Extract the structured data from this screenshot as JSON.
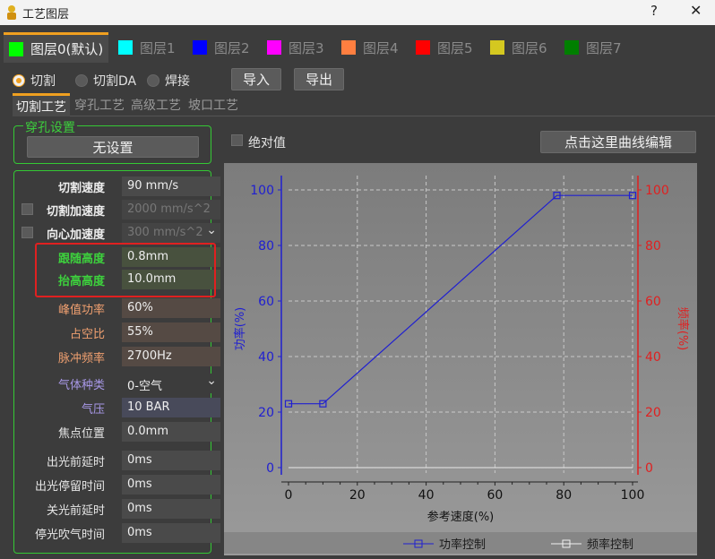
{
  "window": {
    "title": "工艺图层",
    "help": "?",
    "close": "✕"
  },
  "layers": [
    {
      "label": "图层0(默认)",
      "color": "#00ff00"
    },
    {
      "label": "图层1",
      "color": "#00ffff"
    },
    {
      "label": "图层2",
      "color": "#0000ff"
    },
    {
      "label": "图层3",
      "color": "#ff00ff"
    },
    {
      "label": "图层4",
      "color": "#ff7f40"
    },
    {
      "label": "图层5",
      "color": "#ff0000"
    },
    {
      "label": "图层6",
      "color": "#d4c820"
    },
    {
      "label": "图层7",
      "color": "#007f00"
    }
  ],
  "modes": {
    "cut": "切割",
    "cut_da": "切割DA",
    "weld": "焊接",
    "selected": "切割"
  },
  "actions": {
    "import": "导入",
    "export": "导出"
  },
  "sub_tabs": [
    "切割工艺",
    "穿孔工艺",
    "高级工艺",
    "坡口工艺"
  ],
  "pierce": {
    "title": "穿孔设置",
    "button": "无设置"
  },
  "absolute": {
    "label": "绝对值"
  },
  "edit_curve": "点击这里曲线编辑",
  "params": {
    "cut_speed": {
      "label": "切割速度",
      "value": "90 mm/s"
    },
    "cut_accel": {
      "label": "切割加速度",
      "value": "2000 mm/s^2"
    },
    "centri_accel": {
      "label": "向心加速度",
      "value": "300 mm/s^2"
    },
    "follow_height": {
      "label": "跟随高度",
      "value": "0.8mm"
    },
    "lift_height": {
      "label": "抬高高度",
      "value": "10.0mm"
    },
    "peak_power": {
      "label": "峰值功率",
      "value": "60%"
    },
    "duty": {
      "label": "占空比",
      "value": "55%"
    },
    "pulse_freq": {
      "label": "脉冲频率",
      "value": "2700Hz"
    },
    "gas_type": {
      "label": "气体种类",
      "value": "0-空气"
    },
    "pressure": {
      "label": "气压",
      "value": "10 BAR"
    },
    "focus": {
      "label": "焦点位置",
      "value": "0.0mm"
    },
    "pre_delay": {
      "label": "出光前延时",
      "value": "0ms"
    },
    "stay_time": {
      "label": "出光停留时间",
      "value": "0ms"
    },
    "off_delay": {
      "label": "关光前延时",
      "value": "0ms"
    },
    "blow_time": {
      "label": "停光吹气时间",
      "value": "0ms"
    }
  },
  "colors": {
    "green_label": "#3dd13d",
    "orange_label": "#f0a070",
    "purple_label": "#a898e8",
    "power_axis": "#2020d0",
    "freq_axis": "#e02020"
  },
  "chart_data": {
    "type": "line",
    "xlabel": "参考速度(%)",
    "ylabel": "功率(%)",
    "y2label": "频率(%)",
    "xlim": [
      0,
      100
    ],
    "ylim": [
      0,
      100
    ],
    "y2lim": [
      0,
      100
    ],
    "x_ticks": [
      0,
      20,
      40,
      60,
      80,
      100
    ],
    "y_ticks": [
      0,
      20,
      40,
      60,
      80,
      100
    ],
    "y2_ticks": [
      0,
      20,
      40,
      60,
      80,
      100
    ],
    "grid": true,
    "series": [
      {
        "name": "功率控制",
        "color": "#2020d0",
        "x": [
          0,
          10,
          78,
          100
        ],
        "y": [
          23,
          23,
          98,
          98
        ]
      },
      {
        "name": "频率控制",
        "color": "#f0f0f0",
        "x": [
          0,
          100
        ],
        "y": [
          0,
          0
        ]
      }
    ],
    "legend": "bottom"
  }
}
